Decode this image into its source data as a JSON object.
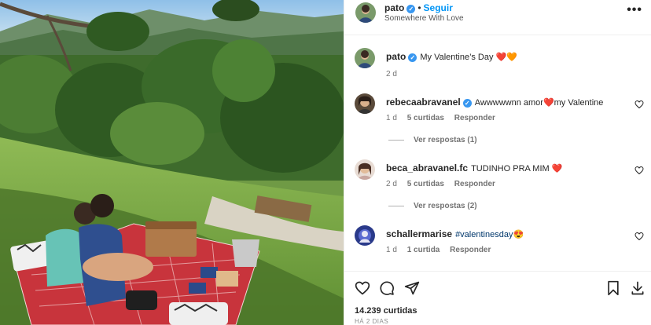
{
  "post": {
    "author": "pato",
    "follow_label": "Seguir",
    "location": "Somewhere With Love",
    "separator": "•",
    "more_label": "•••"
  },
  "caption": {
    "username": "pato",
    "text": "My Valentine’s Day",
    "emoji": "❤️🧡",
    "age": "2 d"
  },
  "comments": [
    {
      "username": "rebecaabravanel",
      "verified": true,
      "text": "Awwwwwnn amor❤️my Valentine",
      "age": "1 d",
      "likes": "5 curtidas",
      "reply_label": "Responder",
      "view_replies": "Ver respostas (1)"
    },
    {
      "username": "beca_abravanel.fc",
      "verified": false,
      "text": "TUDINHO PRA MIM ❤️",
      "age": "2 d",
      "likes": "5 curtidas",
      "reply_label": "Responder",
      "view_replies": "Ver respostas (2)"
    },
    {
      "username": "schallermarise",
      "verified": false,
      "text": "#valentinesday😍",
      "age": "1 d",
      "likes": "1 curtida",
      "reply_label": "Responder"
    }
  ],
  "actions": {
    "icons": [
      "heart-icon",
      "comment-icon",
      "share-icon",
      "save-icon",
      "download-icon"
    ]
  },
  "likes_count": "14.239 curtidas",
  "date_label": "HÁ 2 DIAS",
  "colors": {
    "accent": "#0095f6",
    "verified": "#3897f0",
    "heart": "#ed4956"
  }
}
